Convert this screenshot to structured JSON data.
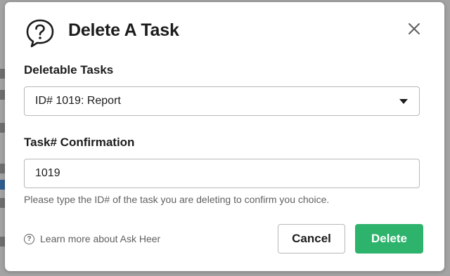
{
  "modal": {
    "title": "Delete A Task",
    "deletable_label": "Deletable Tasks",
    "selected_task": "ID# 1019: Report",
    "confirm_label": "Task# Confirmation",
    "confirm_value": "1019",
    "help_text": "Please type the ID# of the task you are deleting to confirm you choice.",
    "learn_more": "Learn more about Ask Heer",
    "cancel_label": "Cancel",
    "delete_label": "Delete"
  },
  "colors": {
    "primary_green": "#2eb36c",
    "text_dark": "#1d1c1d",
    "text_muted": "#616061"
  },
  "icons": [
    "question-bubble-icon",
    "close-icon",
    "chevron-down-icon",
    "help-circle-icon"
  ]
}
